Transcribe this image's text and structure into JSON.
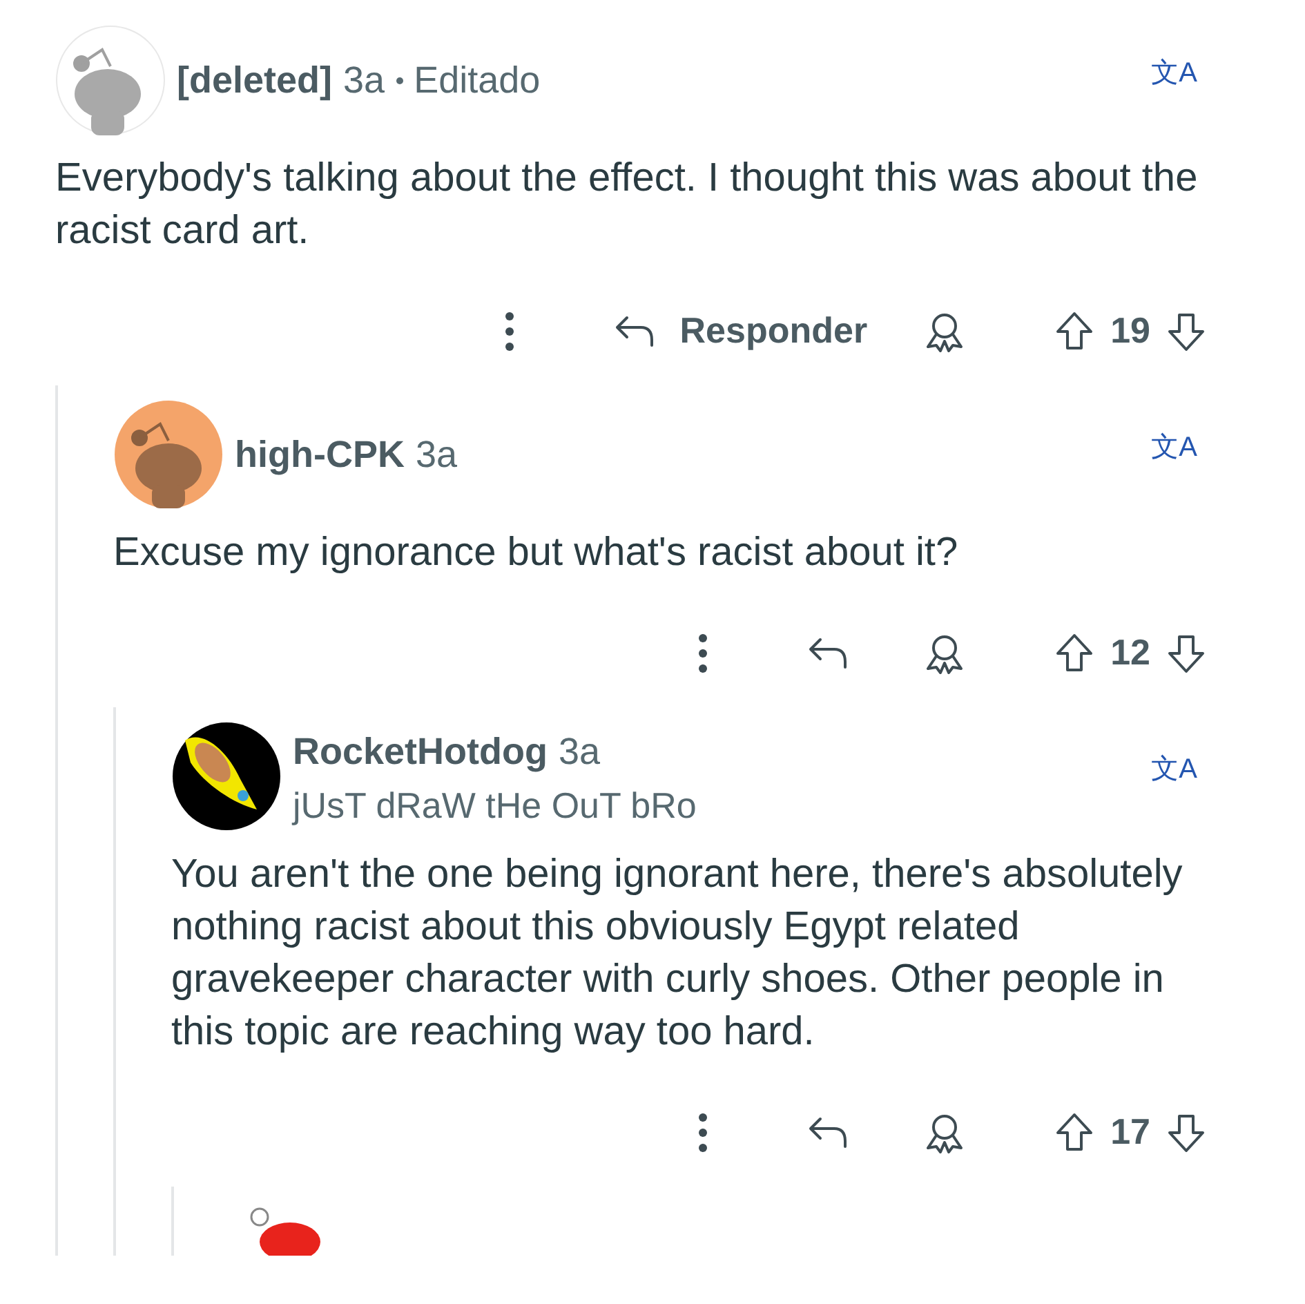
{
  "comments": [
    {
      "avatar": {
        "kind": "deleted"
      },
      "author": "[deleted]",
      "age": "3a",
      "edited": "Editado",
      "translate": "文A",
      "body": "Everybody's talking about the effect. I thought this was about the racist card art.",
      "reply_label": "Responder",
      "votes": "19",
      "children": [
        {
          "avatar": {
            "kind": "orange"
          },
          "author": "high-CPK",
          "age": "3a",
          "translate": "文A",
          "body": "Excuse my ignorance but what's racist about it?",
          "votes": "12",
          "children": [
            {
              "avatar": {
                "kind": "rocket"
              },
              "author": "RocketHotdog",
              "age": "3a",
              "flair": "jUsT dRaW tHe OuT bRo",
              "translate": "文A",
              "body": "You aren't the one being ignorant here, there's absolutely nothing racist about this obviously Egypt related gravekeeper character with curly shoes. Other people in this topic are reaching way too hard.",
              "votes": "17",
              "children": [
                {
                  "avatar": {
                    "kind": "clipped"
                  }
                }
              ]
            }
          ]
        }
      ]
    }
  ]
}
